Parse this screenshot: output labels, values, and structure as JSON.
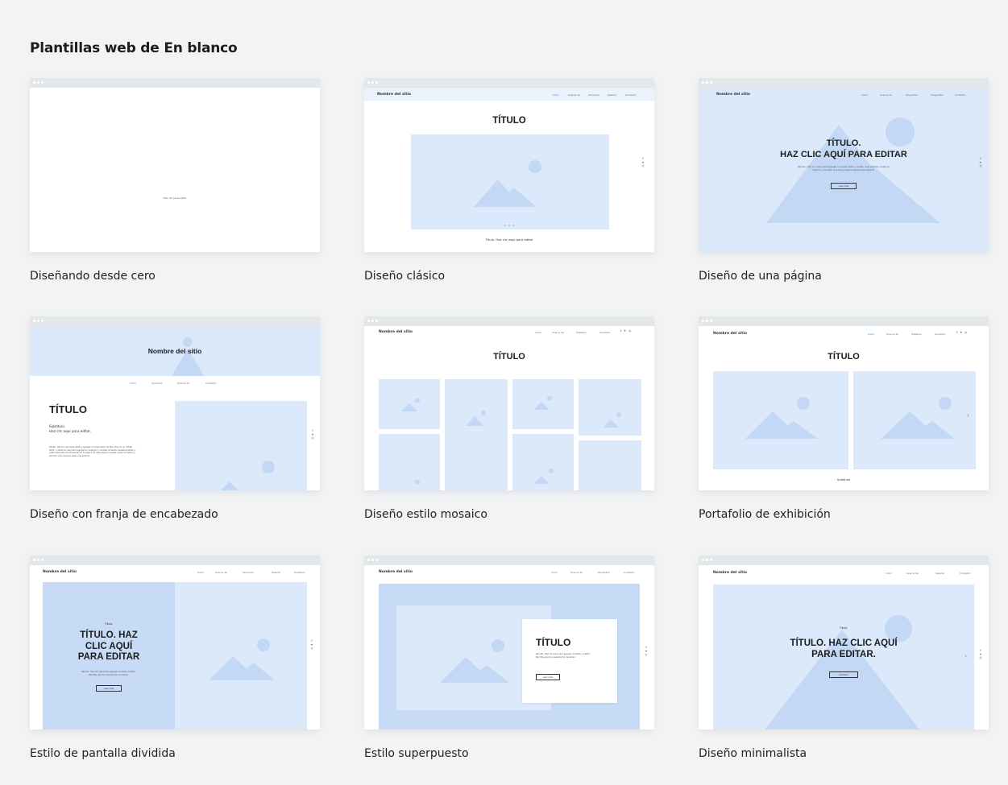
{
  "page": {
    "heading": "Plantillas web de En blanco"
  },
  "colors": {
    "background": "#f2f3f4",
    "placeholder": "#dbe9fb",
    "placeholder_shape": "#c3d8f5",
    "link_accent": "#3b7de0"
  },
  "templates": [
    {
      "label": "Diseñando desde cero",
      "content": {
        "center_text": "Haz clic para editar"
      }
    },
    {
      "label": "Diseño clásico",
      "content": {
        "site_name": "Nombre del sitio",
        "nav": [
          "Inicio",
          "Acerca de",
          "Servicios",
          "Galería",
          "Contacto"
        ],
        "title": "TÍTULO",
        "caption": "Título. Haz clic aquí para editar"
      }
    },
    {
      "label": "Diseño de una página",
      "content": {
        "site_name": "Nombre del sitio",
        "nav": [
          "Inicio",
          "Acerca de",
          "Proyectos",
          "Preguntas",
          "Contacto"
        ],
        "title_line1": "TÍTULO.",
        "title_line2": "HAZ CLIC AQUÍ PARA EDITAR",
        "paragraph": "Párrafo. Haz clic aquí para agregar tu propio texto y editar. Aquí puedes contar tu historia y permitir que tus usuarios sepan más sobre ti.",
        "button": "Leer más"
      }
    },
    {
      "label": "Diseño con franja de encabezado",
      "content": {
        "site_name": "Nombre del sitio",
        "nav": [
          "Inicio",
          "Servicios",
          "Acerca de",
          "Contacto"
        ],
        "title": "TÍTULO",
        "subtitle_line1": "Subtítulo.",
        "subtitle_line2": "Haz clic aquí para editar.",
        "paragraph": "Párrafo. Haz clic aquí para editar y agregar tu propio texto. Es fácil. Haz clic en \"Editar texto\" o doble clic aquí para agregar tu contenido y cambiar la fuente. Puedes arrastrar y soltar este texto donde quieras en tu página. En este espacio puedes contar tu historia y permitir a tus usuarios saber más sobre ti."
      }
    },
    {
      "label": "Diseño estilo mosaico",
      "content": {
        "site_name": "Nombre del sitio",
        "nav": [
          "Inicio",
          "Acerca de",
          "Trabajos",
          "Contacto"
        ],
        "title": "TÍTULO"
      }
    },
    {
      "label": "Portafolio de exhibición",
      "content": {
        "site_name": "Nombre del sitio",
        "nav": [
          "Inicio",
          "Acerca de",
          "Trabajos",
          "Contacto"
        ],
        "title": "TÍTULO",
        "caption": "Subtítulo"
      }
    },
    {
      "label": "Estilo de pantalla dividida",
      "content": {
        "site_name": "Nombre del sitio",
        "nav": [
          "Inicio",
          "Acerca de",
          "Servicios",
          "Galería",
          "Contacto"
        ],
        "kicker": "Título.",
        "title_line1": "TÍTULO. HAZ",
        "title_line2": "CLIC AQUÍ",
        "title_line3": "PARA EDITAR",
        "paragraph": "Párrafo. Haz clic aquí para agregar tu texto y editar. Permite que tus usuarios te conozcan.",
        "button": "Leer más"
      }
    },
    {
      "label": "Estilo superpuesto",
      "content": {
        "site_name": "Nombre del sitio",
        "nav": [
          "Inicio",
          "Acerca de",
          "Proyectos",
          "Contacto"
        ],
        "title": "TÍTULO",
        "paragraph": "Párrafo. Haz clic aquí para agregar tu texto y editar. Permite que tus usuarios te conozcan.",
        "button": "Leer más"
      }
    },
    {
      "label": "Diseño minimalista",
      "content": {
        "site_name": "Nombre del sitio",
        "nav": [
          "Inicio",
          "Acerca de",
          "Galería",
          "Contacto"
        ],
        "kicker": "Título.",
        "title_line1": "TÍTULO. HAZ CLIC AQUÍ",
        "title_line2": "PARA EDITAR.",
        "button": "Contacto"
      }
    }
  ]
}
